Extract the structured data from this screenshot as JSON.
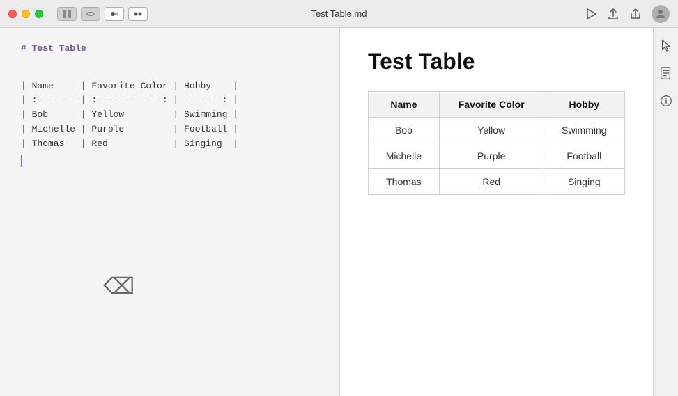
{
  "titlebar": {
    "title": "Test Table.md",
    "traffic_lights": {
      "close": "close",
      "minimize": "minimize",
      "maximize": "maximize"
    },
    "toolbar": {
      "btn1": "⊞",
      "btn2": "⇄",
      "btn3": "●",
      "btn4": "● ●"
    }
  },
  "editor": {
    "heading": "# Test Table",
    "lines": [
      "| Name     | Favorite Color | Hobby    |",
      "| :------- | :------------: | -------: |",
      "| Bob      | Yellow         | Swimming |",
      "| Michelle | Purple         | Football |",
      "| Thomas   | Red            | Singing  |"
    ]
  },
  "preview": {
    "title": "Test Table",
    "table": {
      "headers": [
        "Name",
        "Favorite Color",
        "Hobby"
      ],
      "rows": [
        [
          "Bob",
          "Yellow",
          "Swimming"
        ],
        [
          "Michelle",
          "Purple",
          "Football"
        ],
        [
          "Thomas",
          "Red",
          "Singing"
        ]
      ]
    }
  },
  "right_sidebar": {
    "icons": [
      "cursor-icon",
      "document-icon",
      "info-icon"
    ]
  }
}
